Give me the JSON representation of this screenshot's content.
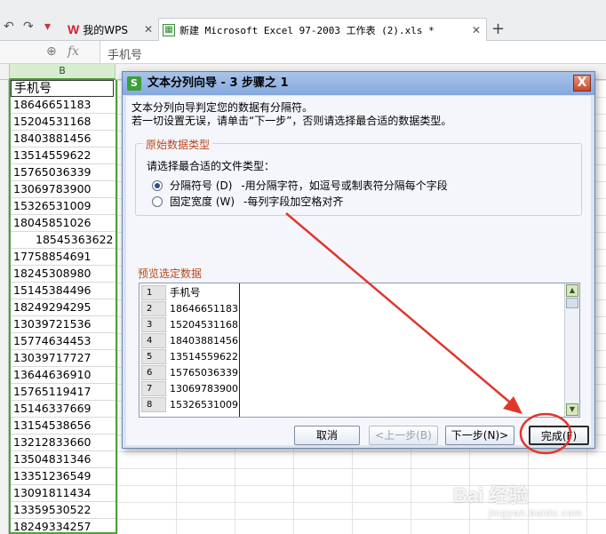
{
  "tabs": {
    "wps_label": "我的WPS",
    "doc_label": "新建 Microsoft Excel 97-2003 工作表 (2).xls *"
  },
  "formula_bar": {
    "fx": "fx",
    "content": "手机号"
  },
  "sheet": {
    "column_b": "B",
    "cells": [
      "手机号",
      "18646651183",
      "15204531168",
      "18403881456",
      "13514559622",
      "15765036339",
      "13069783900",
      "15326531009",
      "18045851026",
      "18545363622",
      "17758854691",
      "18245308980",
      "15145384496",
      "18249294295",
      "13039721536",
      "15774634453",
      "13039717727",
      "13644636910",
      "15765119417",
      "15146337669",
      "13154538656",
      "13212833660",
      "13504831346",
      "13351236549",
      "13091811434",
      "13359530522",
      "18249334257"
    ]
  },
  "dialog": {
    "title": "文本分列向导 - 3 步骤之 1",
    "close": "X",
    "instr1": "文本分列向导判定您的数据有分隔符。",
    "instr2": "若一切设置无误，请单击“下一步”，否则请选择最合适的数据类型。",
    "group_original": "原始数据类型",
    "choose_prompt": "请选择最合适的文件类型：",
    "option1_label": "分隔符号 (D)",
    "option1_desc": "-用分隔字符，如逗号或制表符分隔每个字段",
    "option2_label": "固定宽度 (W)",
    "option2_desc": "-每列字段加空格对齐",
    "group_preview": "预览选定数据",
    "preview_rows": [
      {
        "num": "1",
        "val": "手机号"
      },
      {
        "num": "2",
        "val": "18646651183"
      },
      {
        "num": "3",
        "val": "15204531168"
      },
      {
        "num": "4",
        "val": "18403881456"
      },
      {
        "num": "5",
        "val": "13514559622"
      },
      {
        "num": "6",
        "val": "15765036339"
      },
      {
        "num": "7",
        "val": "13069783900"
      },
      {
        "num": "8",
        "val": "15326531009"
      }
    ],
    "btn_cancel": "取消",
    "btn_prev": "<上一步(B)",
    "btn_next": "下一步(N)>",
    "btn_finish": "完成(F)"
  },
  "colors": {
    "annotation_red": "#e0362c",
    "selection_green": "#4fa03d"
  },
  "watermark": {
    "main": "Bai 经验",
    "sub": "jingyan.baidu.com"
  }
}
